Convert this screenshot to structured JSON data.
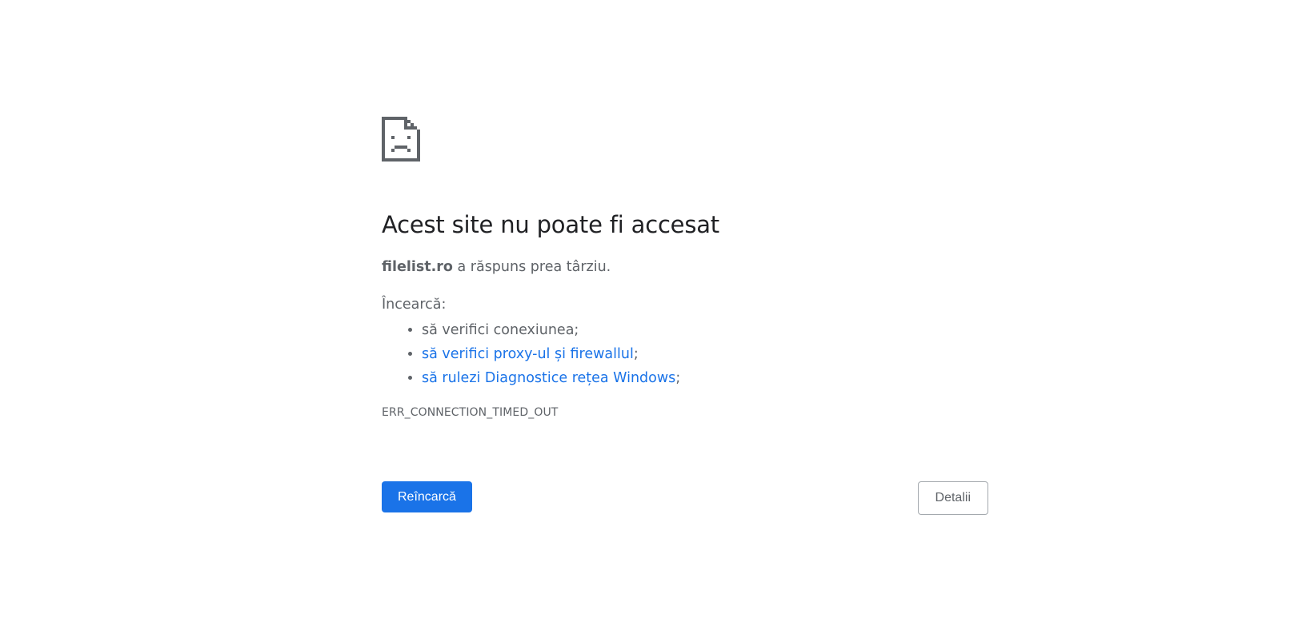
{
  "error_page": {
    "icon": "sad-document-icon",
    "title": "Acest site nu poate fi accesat",
    "summary": {
      "host": "filelist.ro",
      "text": " a răspuns prea târziu."
    },
    "suggestions_heading": "Încearcă:",
    "suggestions": [
      {
        "text": "să verifici conexiunea;"
      },
      {
        "link": "să verifici proxy-ul și firewallul",
        "suffix": ";"
      },
      {
        "link": "să rulezi Diagnostice rețea Windows",
        "suffix": ";"
      }
    ],
    "error_code": "ERR_CONNECTION_TIMED_OUT"
  },
  "buttons": {
    "reload_label": "Reîncarcă",
    "details_label": "Detalii"
  },
  "colors": {
    "accent": "#1a73e8",
    "title": "#202124",
    "body_text": "#5f6368",
    "icon": "#5f6368"
  }
}
